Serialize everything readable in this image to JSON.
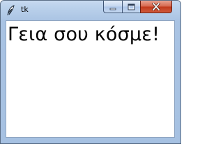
{
  "window": {
    "title": "tk",
    "app_icon": "feather-icon",
    "controls": {
      "minimize_icon": "minimize-icon",
      "maximize_icon": "maximize-icon",
      "close_icon": "close-icon"
    }
  },
  "content": {
    "label_text": "Γεια σου κόσμε!"
  },
  "colors": {
    "client_background": "#ffffff",
    "frame": "#a9c3e3",
    "close_button": "#c94a2e"
  }
}
